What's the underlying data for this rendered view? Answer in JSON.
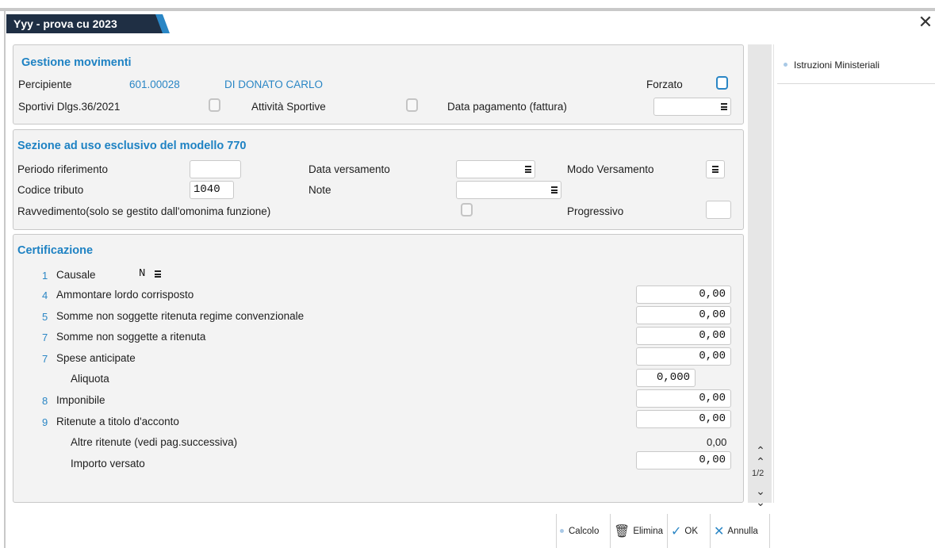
{
  "window": {
    "title": "Yyy - prova cu 2023",
    "close": "✕"
  },
  "gestione": {
    "title": "Gestione movimenti",
    "percipiente_label": "Percipiente",
    "percipiente_code": "601.00028",
    "percipiente_name": "DI DONATO CARLO",
    "forzato_label": "Forzato",
    "sportivi_label": "Sportivi Dlgs.36/2021",
    "attivita_label": "Attività Sportive",
    "data_pagamento_label": "Data pagamento (fattura)",
    "data_pagamento_value": ""
  },
  "sezione770": {
    "title": "Sezione ad uso esclusivo del modello 770",
    "periodo_label": "Periodo riferimento",
    "periodo_value": "",
    "data_versamento_label": "Data versamento",
    "data_versamento_value": "",
    "modo_versamento_label": "Modo Versamento",
    "codice_tributo_label": "Codice tributo",
    "codice_tributo_value": "1040",
    "note_label": "Note",
    "note_value": "",
    "ravvedimento_label": "Ravvedimento(solo se gestito dall'omonima funzione)",
    "progressivo_label": "Progressivo",
    "progressivo_value": ""
  },
  "certificazione": {
    "title": "Certificazione",
    "causale": {
      "num": "1",
      "label": "Causale",
      "value": "N"
    },
    "ammontare": {
      "num": "4",
      "label": "Ammontare lordo corrisposto",
      "value": "0,00"
    },
    "somme_conv": {
      "num": "5",
      "label": "Somme non soggette ritenuta regime convenzionale",
      "value": "0,00"
    },
    "somme_non": {
      "num": "7",
      "label": "Somme non soggette a ritenuta",
      "value": "0,00"
    },
    "spese": {
      "num": "7",
      "label": "Spese anticipate",
      "value": "0,00"
    },
    "aliquota": {
      "label": "Aliquota",
      "value": "0,000"
    },
    "imponibile": {
      "num": "8",
      "label": "Imponibile",
      "value": "0,00"
    },
    "ritenute": {
      "num": "9",
      "label": "Ritenute a titolo d'acconto",
      "value": "0,00"
    },
    "altre": {
      "label": "Altre ritenute (vedi pag.successiva)",
      "value": "0,00"
    },
    "importo": {
      "label": "Importo versato",
      "value": "0,00"
    }
  },
  "scrollbar": {
    "page": "1/2",
    "up": "⌃",
    "down": "⌄"
  },
  "right_pane": {
    "item": "Istruzioni Ministeriali"
  },
  "buttons": {
    "calcolo": "Calcolo",
    "elimina": "Elimina",
    "ok": "OK",
    "annulla": "Annulla"
  },
  "colors": {
    "accent": "#2a86c5",
    "tab_bg": "#1f2f44",
    "panel_bg": "#f3f3f3"
  }
}
